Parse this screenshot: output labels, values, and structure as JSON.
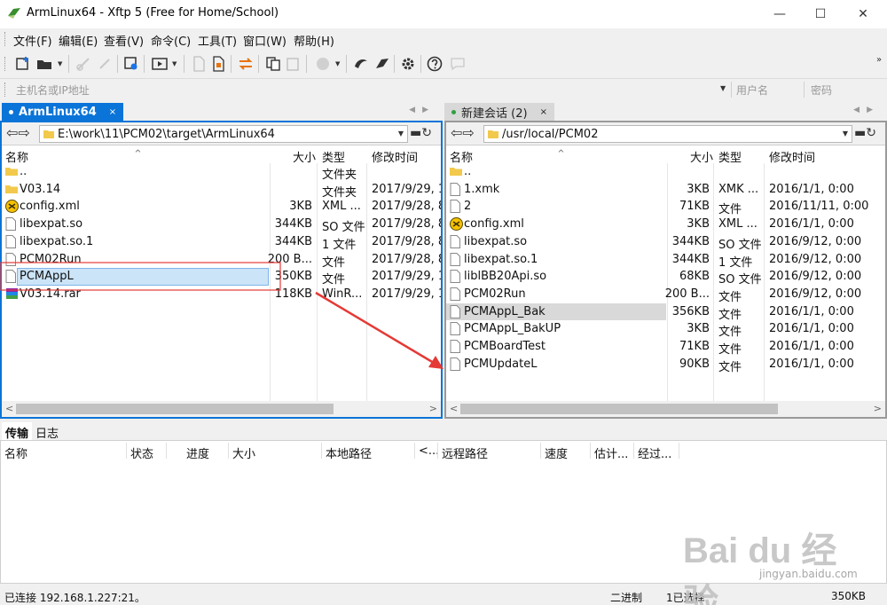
{
  "window": {
    "title": "ArmLinux64 - Xftp 5 (Free for Home/School)",
    "minimize": "—",
    "maximize": "☐",
    "close": "✕"
  },
  "menu": [
    "文件(F)",
    "编辑(E)",
    "查看(V)",
    "命令(C)",
    "工具(T)",
    "窗口(W)",
    "帮助(H)"
  ],
  "address": {
    "host_placeholder": "主机名或IP地址",
    "user_placeholder": "用户名",
    "pass_placeholder": "密码"
  },
  "left_pane": {
    "tab_label": "ArmLinux64",
    "tab_close": "×",
    "path": "E:\\work\\11\\PCM02\\target\\ArmLinux64",
    "columns": [
      "名称",
      "大小",
      "类型",
      "修改时间"
    ],
    "files": [
      {
        "icon": "folder-icon",
        "name": "..",
        "size": "",
        "type": "文件夹",
        "time": ""
      },
      {
        "icon": "folder-icon",
        "name": "V03.14",
        "size": "",
        "type": "文件夹",
        "time": "2017/9/29, 1"
      },
      {
        "icon": "xml-icon",
        "name": "config.xml",
        "size": "3KB",
        "type": "XML ...",
        "time": "2017/9/28, 8"
      },
      {
        "icon": "file-icon",
        "name": "libexpat.so",
        "size": "344KB",
        "type": "SO 文件",
        "time": "2017/9/28, 8"
      },
      {
        "icon": "file-icon",
        "name": "libexpat.so.1",
        "size": "344KB",
        "type": "1 文件",
        "time": "2017/9/28, 8"
      },
      {
        "icon": "file-icon",
        "name": "PCM02Run",
        "size": "200 B...",
        "type": "文件",
        "time": "2017/9/28, 8"
      },
      {
        "icon": "file-icon",
        "name": "PCMAppL",
        "size": "350KB",
        "type": "文件",
        "time": "2017/9/29, 1",
        "editing": true
      },
      {
        "icon": "rar-icon",
        "name": "V03.14.rar",
        "size": "118KB",
        "type": "WinR...",
        "time": "2017/9/29, 1"
      }
    ]
  },
  "right_pane": {
    "tab_label": "新建会话 (2)",
    "tab_close": "×",
    "path": "/usr/local/PCM02",
    "columns": [
      "名称",
      "大小",
      "类型",
      "修改时间"
    ],
    "files": [
      {
        "icon": "folder-icon",
        "name": "..",
        "size": "",
        "type": "",
        "time": ""
      },
      {
        "icon": "file-icon",
        "name": "1.xmk",
        "size": "3KB",
        "type": "XMK ...",
        "time": "2016/1/1, 0:00"
      },
      {
        "icon": "file-icon",
        "name": "2",
        "size": "71KB",
        "type": "文件",
        "time": "2016/11/11, 0:00"
      },
      {
        "icon": "xml-icon",
        "name": "config.xml",
        "size": "3KB",
        "type": "XML ...",
        "time": "2016/1/1, 0:00"
      },
      {
        "icon": "file-icon",
        "name": "libexpat.so",
        "size": "344KB",
        "type": "SO 文件",
        "time": "2016/9/12, 0:00"
      },
      {
        "icon": "file-icon",
        "name": "libexpat.so.1",
        "size": "344KB",
        "type": "1 文件",
        "time": "2016/9/12, 0:00"
      },
      {
        "icon": "file-icon",
        "name": "liblBB20Api.so",
        "size": "68KB",
        "type": "SO 文件",
        "time": "2016/9/12, 0:00"
      },
      {
        "icon": "file-icon",
        "name": "PCM02Run",
        "size": "200 B...",
        "type": "文件",
        "time": "2016/9/12, 0:00"
      },
      {
        "icon": "file-icon",
        "name": "PCMAppL_Bak",
        "size": "356KB",
        "type": "文件",
        "time": "2016/1/1, 0:00",
        "selected": true
      },
      {
        "icon": "file-icon",
        "name": "PCMAppL_BakUP",
        "size": "3KB",
        "type": "文件",
        "time": "2016/1/1, 0:00"
      },
      {
        "icon": "file-icon",
        "name": "PCMBoardTest",
        "size": "71KB",
        "type": "文件",
        "time": "2016/1/1, 0:00"
      },
      {
        "icon": "file-icon",
        "name": "PCMUpdateL",
        "size": "90KB",
        "type": "文件",
        "time": "2016/1/1, 0:00"
      }
    ]
  },
  "transfer": {
    "tabs": [
      "传输",
      "日志"
    ],
    "columns": [
      "名称",
      "状态",
      "进度",
      "大小",
      "本地路径",
      "<...",
      "远程路径",
      "速度",
      "估计...",
      "经过..."
    ]
  },
  "status": {
    "connection": "已连接 192.168.1.227:21。",
    "mode": "二进制",
    "selection": "1已选择",
    "size": "350KB"
  },
  "watermark": {
    "brand": "Bai du 经验",
    "url": "jingyan.baidu.com"
  },
  "colors": {
    "accent": "#0a74d8",
    "annotation_red": "#e53935"
  }
}
